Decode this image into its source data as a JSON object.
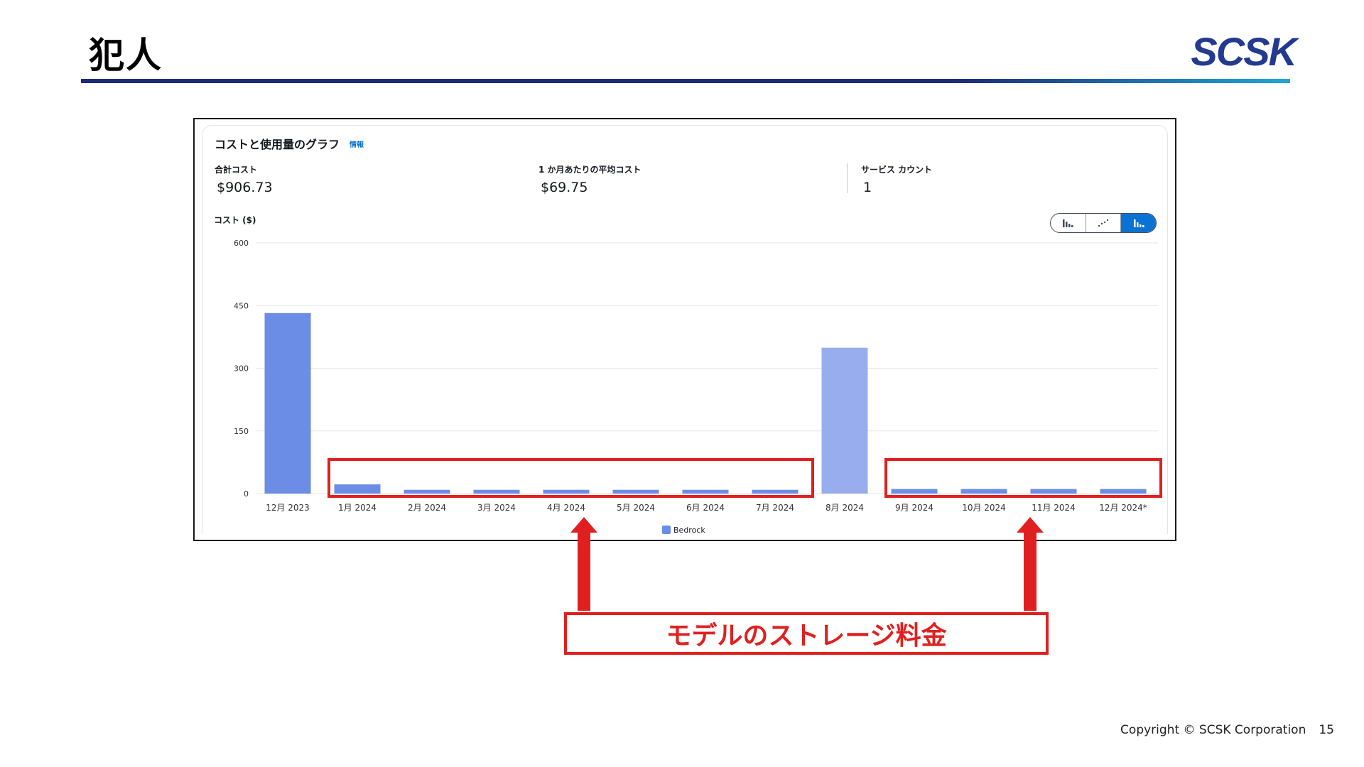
{
  "slide": {
    "title": "犯人",
    "logo": "SCSK",
    "copyright": "Copyright © SCSK Corporation",
    "page_number": "15",
    "callout": "モデルのストレージ料金"
  },
  "panel": {
    "title": "コストと使用量のグラフ",
    "info_link": "情報",
    "metrics": [
      {
        "label": "合計コスト",
        "value": "$906.73"
      },
      {
        "label": "1 か月あたりの平均コスト",
        "value": "$69.75"
      },
      {
        "label": "サービス カウント",
        "value": "1"
      }
    ],
    "chart_type_toggle": [
      {
        "name": "bar-chart-icon",
        "active": false
      },
      {
        "name": "line-chart-icon",
        "active": false
      },
      {
        "name": "stacked-bar-chart-icon",
        "active": true
      }
    ]
  },
  "chart_data": {
    "type": "bar",
    "ylabel": "コスト ($)",
    "ylim": [
      0,
      600
    ],
    "yticks": [
      0,
      150,
      300,
      450,
      600
    ],
    "categories": [
      "12月 2023",
      "1月 2024",
      "2月 2024",
      "3月 2024",
      "4月 2024",
      "5月 2024",
      "6月 2024",
      "7月 2024",
      "8月 2024",
      "9月 2024",
      "10月 2024",
      "11月 2024",
      "12月 2024*"
    ],
    "series": [
      {
        "name": "Bedrock",
        "values": [
          432,
          22,
          9,
          9,
          9,
          9,
          9,
          9,
          349,
          11,
          11,
          11,
          11
        ]
      }
    ],
    "colors": {
      "bar": "#6b8de6",
      "bar_highlight": "#97adee",
      "grid": "#e6e6e6",
      "annotation": "#e02020"
    },
    "highlighted_index": 8,
    "annotation_groups": [
      [
        1,
        7
      ],
      [
        9,
        12
      ]
    ],
    "grid": true,
    "legend_position": "bottom"
  }
}
